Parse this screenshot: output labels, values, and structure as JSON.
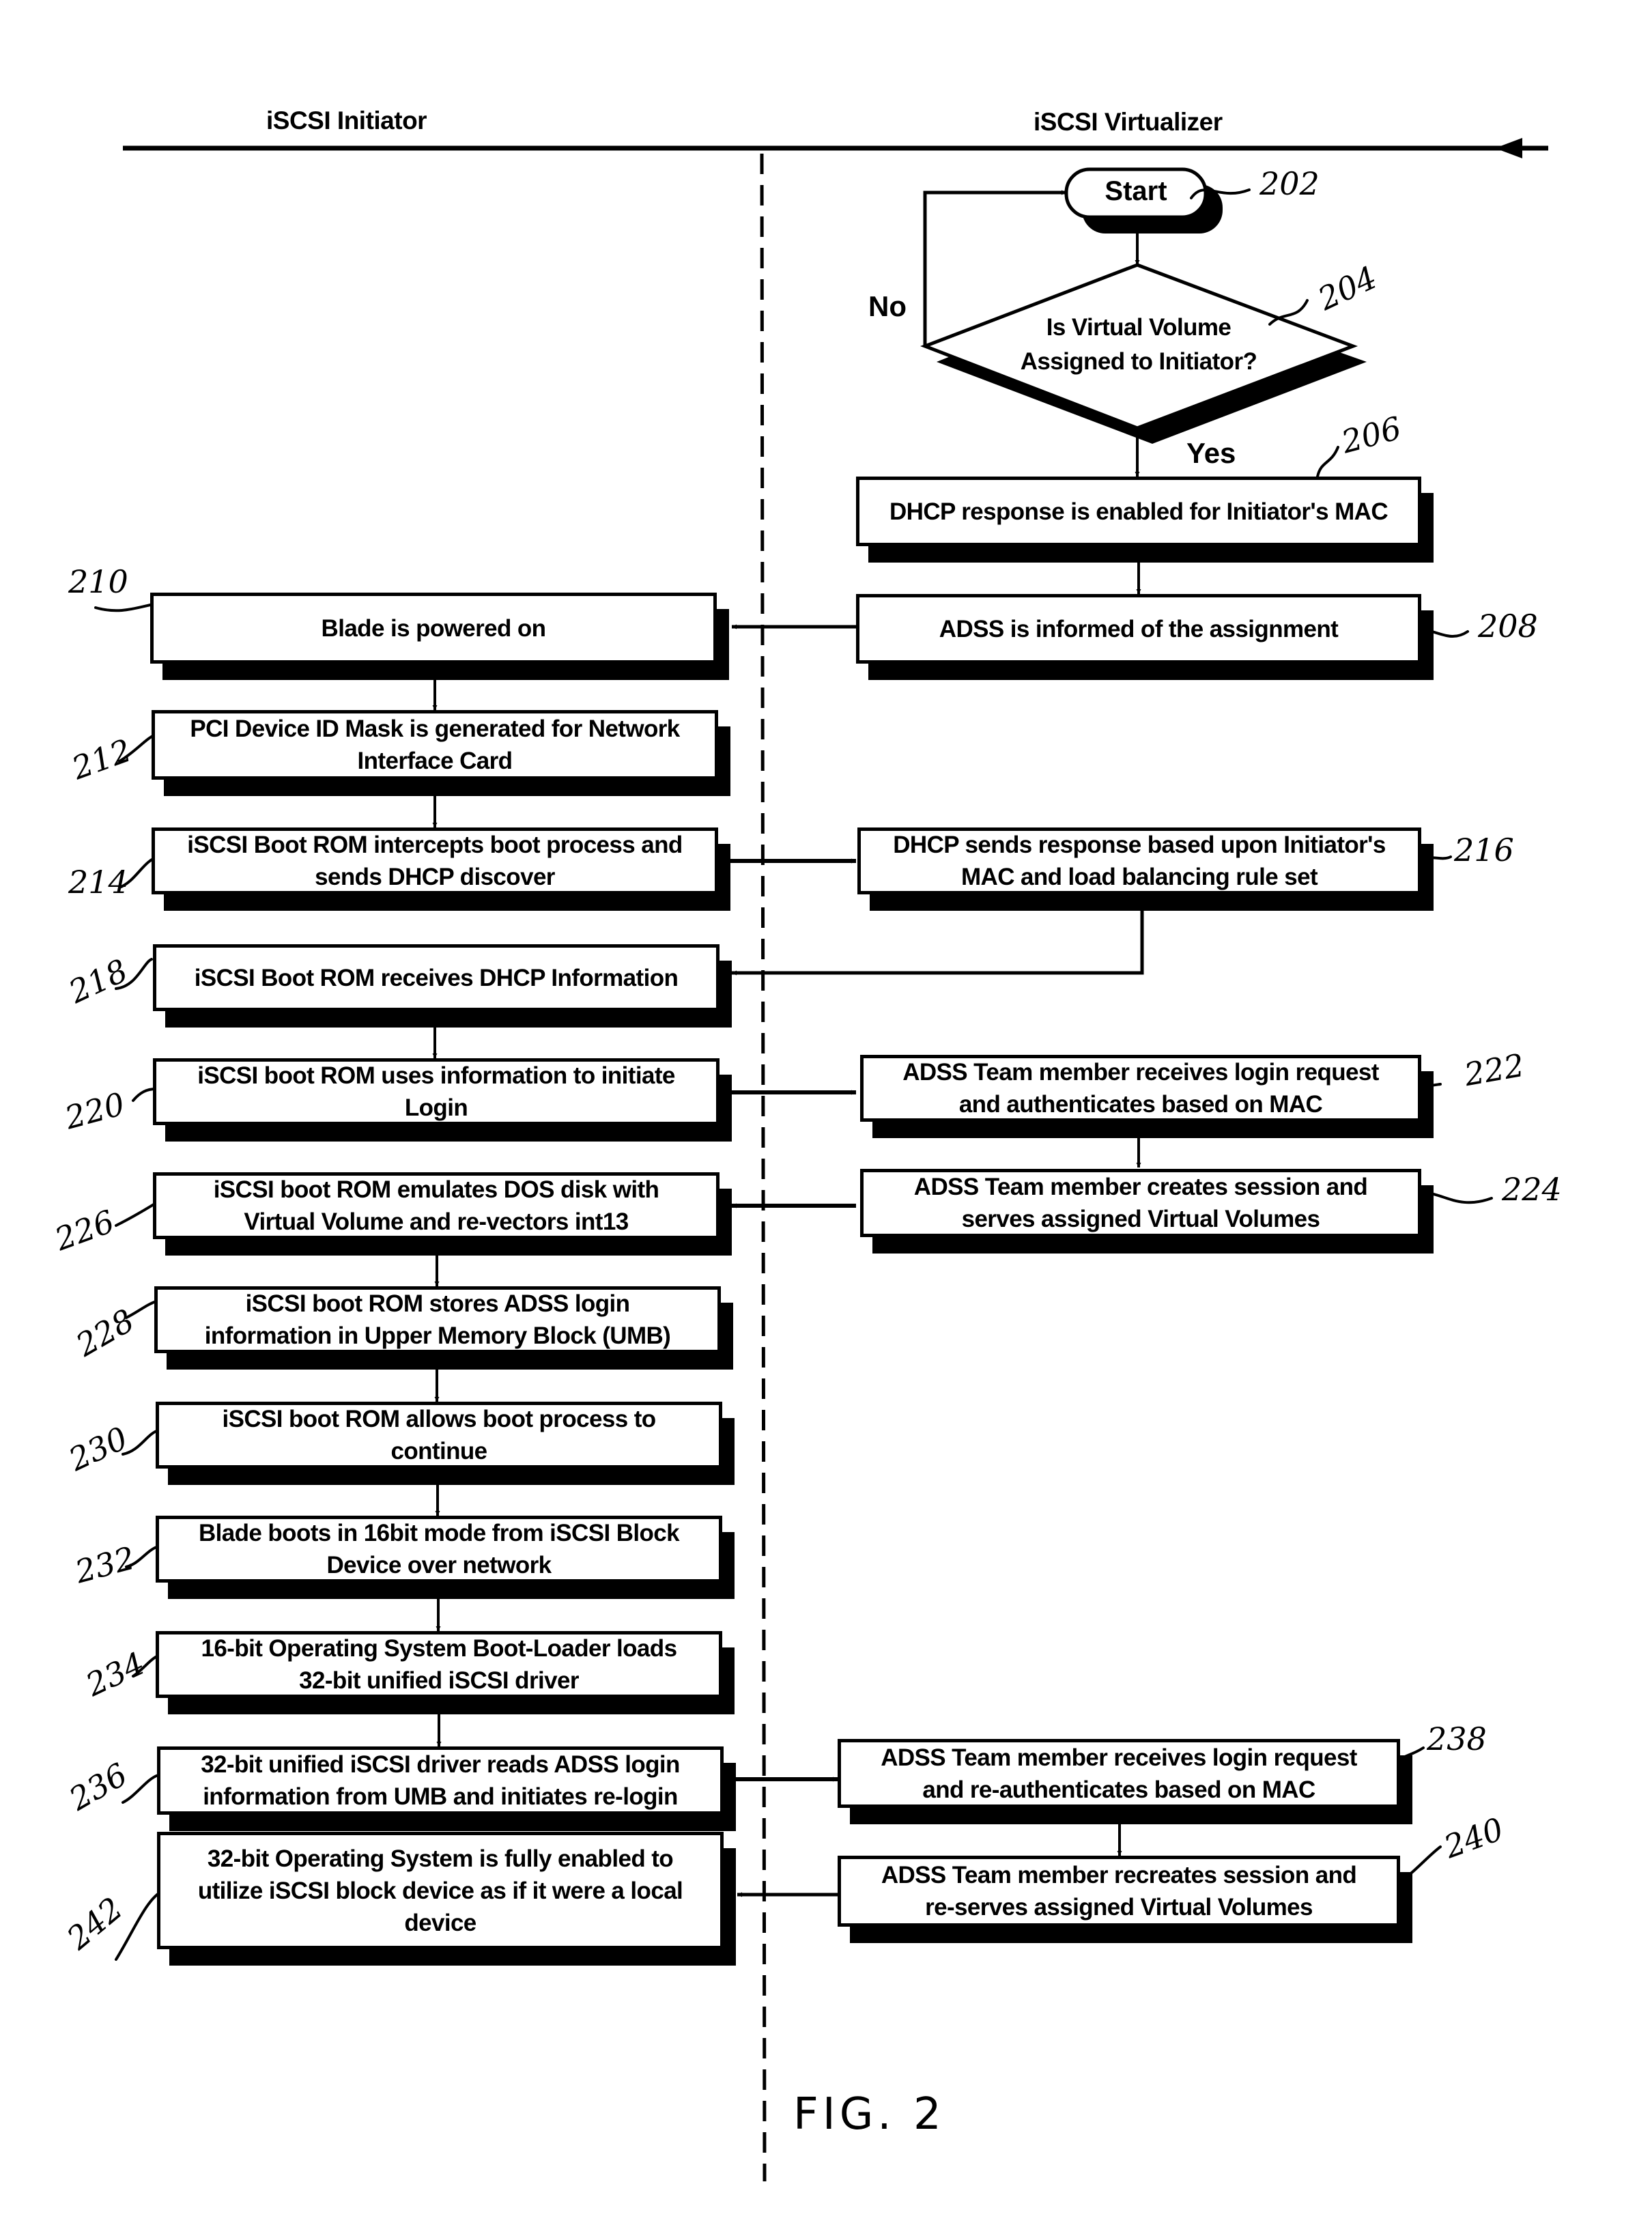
{
  "lanes": {
    "left_title": "iSCSI Initiator",
    "right_title": "iSCSI Virtualizer"
  },
  "start": {
    "label": "Start",
    "ref": "202"
  },
  "decision": {
    "line1": "Is Virtual Volume",
    "line2": "Assigned to Initiator?",
    "ref": "204",
    "no_label": "No",
    "yes_label": "Yes"
  },
  "steps": {
    "s206": {
      "ref": "206",
      "text": "DHCP response is enabled for Initiator's MAC"
    },
    "s208": {
      "ref": "208",
      "text": "ADSS is informed of the assignment"
    },
    "s210": {
      "ref": "210",
      "text": "Blade is powered on"
    },
    "s212": {
      "ref": "212",
      "line1": "PCI Device ID Mask is generated for Network",
      "line2": "Interface Card"
    },
    "s214": {
      "ref": "214",
      "line1": "iSCSI Boot ROM intercepts boot process and",
      "line2": "sends DHCP discover"
    },
    "s216": {
      "ref": "216",
      "line1": "DHCP sends response based upon Initiator's",
      "line2": "MAC and load balancing rule set"
    },
    "s218": {
      "ref": "218",
      "text": "iSCSI Boot ROM receives DHCP Information"
    },
    "s220": {
      "ref": "220",
      "line1": "iSCSI boot ROM uses information to initiate",
      "line2": "Login"
    },
    "s222": {
      "ref": "222",
      "line1": "ADSS Team member receives login request",
      "line2": "and authenticates based on MAC"
    },
    "s224": {
      "ref": "224",
      "line1": "ADSS Team member creates session and",
      "line2": "serves assigned Virtual Volumes"
    },
    "s226": {
      "ref": "226",
      "line1": "iSCSI boot ROM emulates DOS disk with",
      "line2": "Virtual Volume and re-vectors int13"
    },
    "s228": {
      "ref": "228",
      "line1": "iSCSI boot ROM stores ADSS login",
      "line2": "information in Upper Memory Block (UMB)"
    },
    "s230": {
      "ref": "230",
      "line1": "iSCSI boot ROM allows boot process to",
      "line2": "continue"
    },
    "s232": {
      "ref": "232",
      "line1": "Blade boots in 16bit mode from iSCSI Block",
      "line2": "Device over network"
    },
    "s234": {
      "ref": "234",
      "line1": "16-bit Operating System Boot-Loader loads",
      "line2": "32-bit unified iSCSI driver"
    },
    "s236": {
      "ref": "236",
      "line1": "32-bit unified iSCSI driver reads ADSS login",
      "line2": "information from UMB and initiates re-login"
    },
    "s238": {
      "ref": "238",
      "line1": "ADSS Team member receives login request",
      "line2": "and re-authenticates based on MAC"
    },
    "s240": {
      "ref": "240",
      "line1": "ADSS Team member recreates session and",
      "line2": "re-serves assigned Virtual Volumes"
    },
    "s242": {
      "ref": "242",
      "line1": "32-bit Operating System is fully enabled to",
      "line2": "utilize iSCSI block device as if it were a local",
      "line3": "device"
    }
  },
  "figure_label": "FIG. 2"
}
